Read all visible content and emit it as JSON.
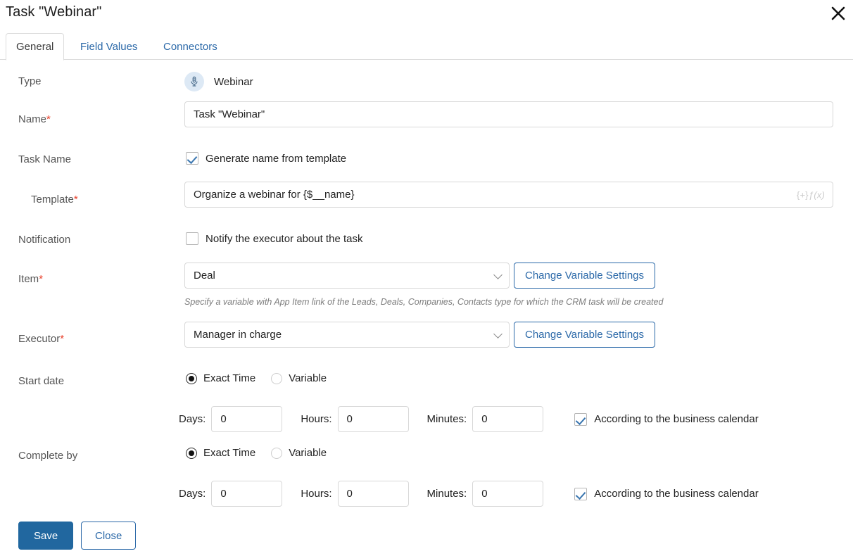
{
  "dialog": {
    "title": "Task \"Webinar\"",
    "close_icon": "close-icon"
  },
  "tabs": [
    {
      "label": "General",
      "active": true
    },
    {
      "label": "Field Values",
      "active": false
    },
    {
      "label": "Connectors",
      "active": false
    }
  ],
  "fields": {
    "type": {
      "label": "Type",
      "icon": "microphone-icon",
      "value": "Webinar"
    },
    "name": {
      "label": "Name",
      "required": "*",
      "value": "Task \"Webinar\"",
      "placeholder": ""
    },
    "task_name": {
      "label": "Task Name",
      "checkbox_label": "Generate name from template",
      "checked": true
    },
    "template": {
      "label": "Template",
      "required": "*",
      "value": "Organize a webinar for {$__name}",
      "adornment_insert": "{+}",
      "adornment_formula": "ƒ(x)"
    },
    "notification": {
      "label": "Notification",
      "checkbox_label": "Notify the executor about the task",
      "checked": false
    },
    "item": {
      "label": "Item",
      "required": "*",
      "value": "Deal",
      "button_label": "Change Variable Settings",
      "help": "Specify a variable with App Item link of the Leads, Deals, Companies, Contacts type for which the CRM task will be created"
    },
    "executor": {
      "label": "Executor",
      "required": "*",
      "value": "Manager in charge",
      "button_label": "Change Variable Settings"
    },
    "start_date": {
      "label": "Start date",
      "radio_exact": "Exact Time",
      "radio_variable": "Variable",
      "selected": "Exact Time",
      "days_label": "Days:",
      "days_value": "0",
      "hours_label": "Hours:",
      "hours_value": "0",
      "minutes_label": "Minutes:",
      "minutes_value": "0",
      "calendar_label": "According to the business calendar",
      "calendar_checked": true
    },
    "complete_by": {
      "label": "Complete by",
      "radio_exact": "Exact Time",
      "radio_variable": "Variable",
      "selected": "Exact Time",
      "days_label": "Days:",
      "days_value": "0",
      "hours_label": "Hours:",
      "hours_value": "0",
      "minutes_label": "Minutes:",
      "minutes_value": "0",
      "calendar_label": "According to the business calendar",
      "calendar_checked": true
    }
  },
  "footer": {
    "save_label": "Save",
    "close_label": "Close"
  },
  "colors": {
    "accent_blue": "#2a68a8",
    "primary_button": "#21679f",
    "required_red": "#e8412c",
    "icon_bg": "#dde9f5"
  }
}
